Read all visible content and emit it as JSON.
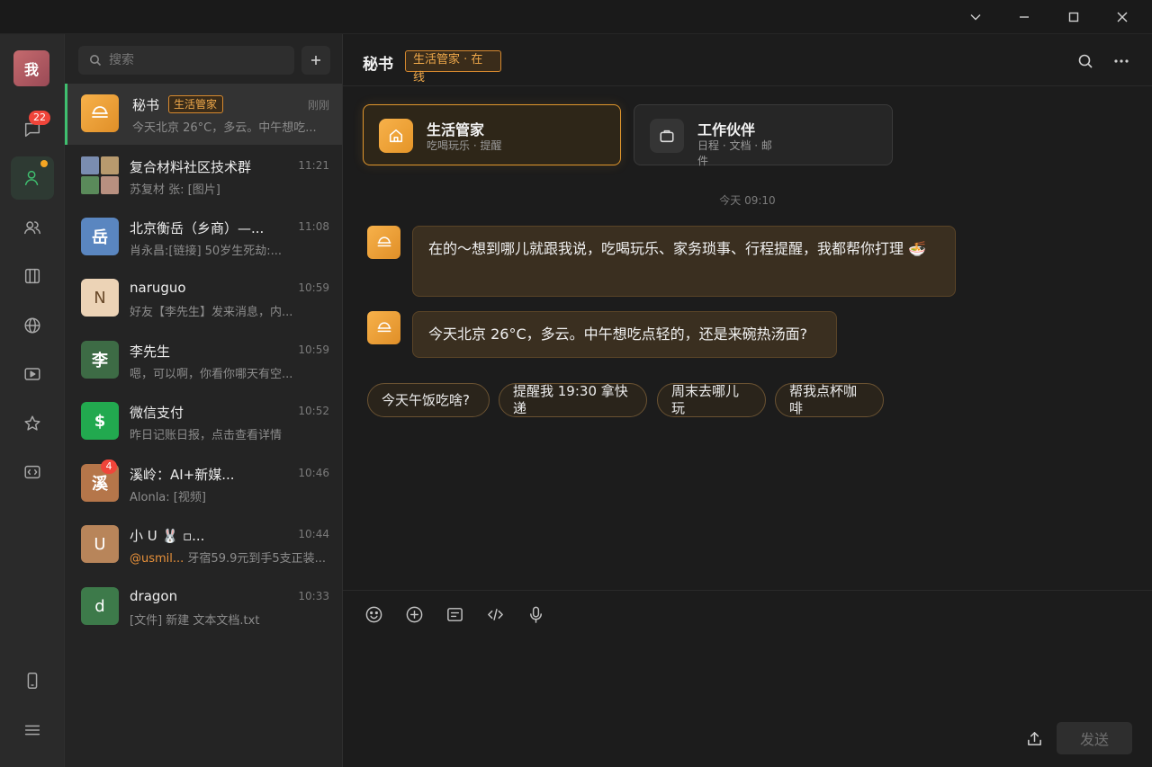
{
  "window": {
    "controls": [
      "chevron-down",
      "minimize",
      "maximize",
      "close"
    ]
  },
  "rail": {
    "me_avatar": "我",
    "chat_badge": "22",
    "items": [
      "chat-icon",
      "contacts-icon",
      "groups-icon",
      "collection-icon",
      "globe-icon",
      "video-icon",
      "star-icon",
      "mini-program-icon"
    ],
    "bottom": [
      "phone-icon",
      "menu-icon"
    ]
  },
  "list": {
    "search_placeholder": "搜索",
    "chats": [
      {
        "name": "秘书",
        "tag": "生活管家",
        "time": "刚刚",
        "preview": "今天北京 26°C，多云。中午想吃...",
        "avatar_color": "#e8982e"
      },
      {
        "name": "复合材料社区技术群",
        "time": "11:21",
        "preview": "苏复材 张: [图片]"
      },
      {
        "name": "北京衡岳（乡商）—...",
        "time": "11:08",
        "preview": "肖永昌:[链接] 50岁生死劫:...",
        "avatar": "岳",
        "avatar_color": "#5a86c0"
      },
      {
        "name": "naruguo",
        "time": "10:59",
        "preview": "好友【李先生】发来消息，内...",
        "avatar": "N",
        "avatar_color": "#ecd3b6"
      },
      {
        "name": "李先生",
        "time": "10:59",
        "preview": "嗯，可以啊，你看你哪天有空...",
        "avatar": "李",
        "avatar_color": "#3d6b45"
      },
      {
        "name": "微信支付",
        "time": "10:52",
        "preview": "昨日记账日报，点击查看详情",
        "avatar": "$",
        "avatar_color": "#22a94f"
      },
      {
        "name": "溪岭：AI+新媒...",
        "time": "10:46",
        "preview": "Alonla: [视频]",
        "avatar": "溪",
        "avatar_color": "#b5764a",
        "badge": "4"
      },
      {
        "name": "小 U 🐰 ▫...",
        "time": "10:44",
        "preview_mention": "@usmil...",
        "preview": " 牙宿59.9元到手5支正装...",
        "avatar": "U",
        "avatar_color": "#b8855a"
      },
      {
        "name": "dragon",
        "time": "10:33",
        "preview": "[文件] 新建 文本文档.txt",
        "avatar": "d",
        "avatar_color": "#3d7a4a"
      }
    ]
  },
  "chat": {
    "title": "秘书",
    "status": "生活管家 · 在线",
    "cards": [
      {
        "title": "生活管家",
        "subtitle": "吃喝玩乐 · 提醒"
      },
      {
        "title": "工作伙伴",
        "subtitle": "日程 · 文档 · 邮件"
      }
    ],
    "day_stamp": "今天 09:10",
    "messages": [
      {
        "text": "在的～想到哪儿就跟我说，吃喝玩乐、家务琐事、行程提醒，我都帮你打理 🍜"
      },
      {
        "text": "今天北京 26°C，多云。中午想吃点轻的，还是来碗热汤面?"
      }
    ],
    "suggestions": [
      "今天午饭吃啥?",
      "提醒我 19:30 拿快递",
      "周末去哪儿玩",
      "帮我点杯咖啡"
    ],
    "send_label": "发送",
    "accent": "#e0962d",
    "green": "#3fbf6f"
  }
}
